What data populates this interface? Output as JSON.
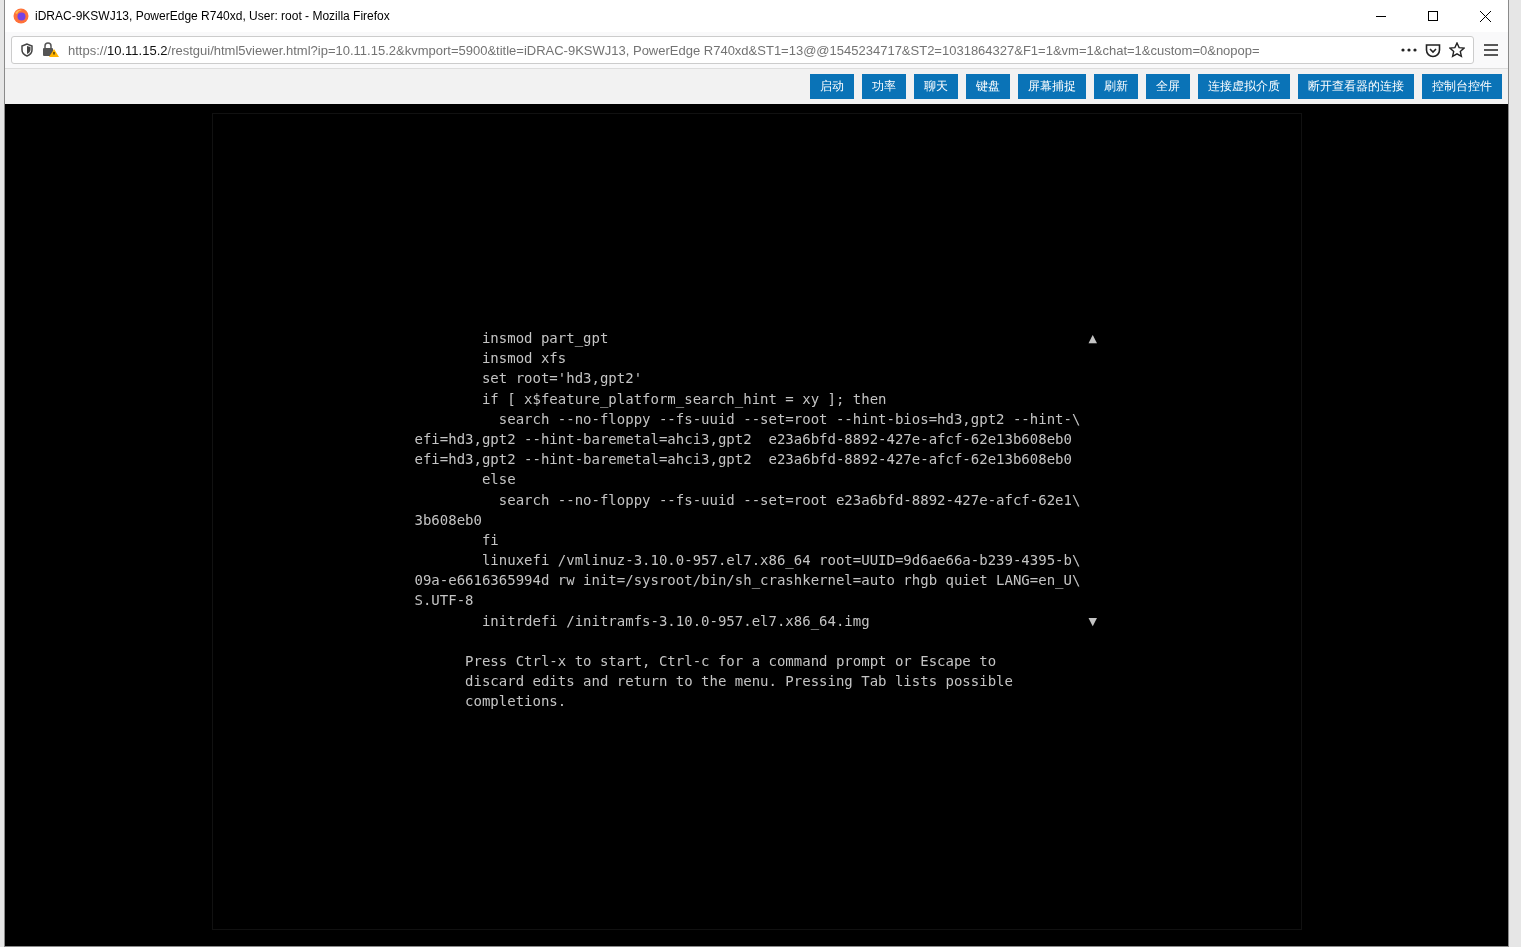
{
  "window": {
    "title": "iDRAC-9KSWJ13, PowerEdge R740xd, User: root - Mozilla Firefox"
  },
  "address_bar": {
    "scheme": "https://",
    "host": "10.11.15.2",
    "path": "/restgui/html5viewer.html?ip=10.11.15.2&kvmport=5900&title=iDRAC-9KSWJ13, PowerEdge R740xd&ST1=13@@1545234717&ST2=1031864327&F1=1&vm=1&chat=1&custom=0&nopop="
  },
  "toolbar": {
    "buttons": [
      "启动",
      "功率",
      "聊天",
      "键盘",
      "屏幕捕捉",
      "刷新",
      "全屏",
      "连接虚拟介质",
      "断开查看器的连接",
      "控制台控件"
    ]
  },
  "console": {
    "scroll_up": "▲",
    "scroll_down": "▼",
    "editor_lines": [
      "        insmod part_gpt",
      "        insmod xfs",
      "        set root='hd3,gpt2'",
      "        if [ x$feature_platform_search_hint = xy ]; then",
      "          search --no-floppy --fs-uuid --set=root --hint-bios=hd3,gpt2 --hint-\\",
      "efi=hd3,gpt2 --hint-baremetal=ahci3,gpt2  e23a6bfd-8892-427e-afcf-62e13b608eb0",
      "efi=hd3,gpt2 --hint-baremetal=ahci3,gpt2  e23a6bfd-8892-427e-afcf-62e13b608eb0",
      "        else",
      "          search --no-floppy --fs-uuid --set=root e23a6bfd-8892-427e-afcf-62e1\\",
      "3b608eb0",
      "        fi",
      "        linuxefi /vmlinuz-3.10.0-957.el7.x86_64 root=UUID=9d6ae66a-b239-4395-b\\",
      "09a-e6616365994d rw init=/sysroot/bin/sh_crashkernel=auto rhgb quiet LANG=en_U\\",
      "S.UTF-8",
      "        initrdefi /initramfs-3.10.0-957.el7.x86_64.img"
    ],
    "help_lines": [
      "      Press Ctrl-x to start, Ctrl-c for a command prompt or Escape to",
      "      discard edits and return to the menu. Pressing Tab lists possible",
      "      completions."
    ]
  }
}
